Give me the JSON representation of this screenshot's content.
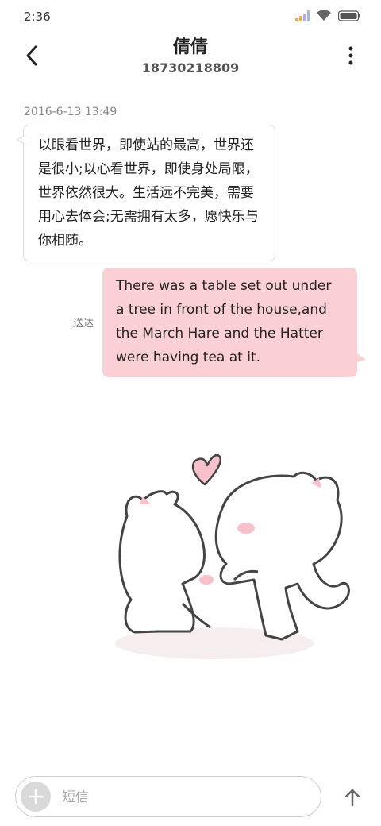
{
  "status_bar": {
    "time": "2:36",
    "signal_icon": "signal-bars-icon",
    "wifi_icon": "wifi-icon",
    "battery_icon": "battery-icon"
  },
  "header": {
    "contact_name": "倩倩",
    "phone": "18730218809",
    "back_icon": "chevron-left-icon",
    "more_icon": "more-vertical-icon"
  },
  "messages": [
    {
      "direction": "incoming",
      "timestamp": "2016-6-13 13:49",
      "text": "以眼看世界，即使站的最高，世界还是很小;以心看世界，即使身处局限，世界依然很大。生活远不完美，需要用心去体会;无需拥有太多，愿快乐与你相随。"
    },
    {
      "direction": "outgoing",
      "status": "送达",
      "text": "There was a table set out under a tree in front of the house,and the March Hare and the Hatter were having tea at it."
    }
  ],
  "sticker": {
    "icon": "kissing-cats-sticker"
  },
  "composer": {
    "placeholder": "短信",
    "add_icon": "plus-icon",
    "send_icon": "arrow-up-icon"
  },
  "colors": {
    "outgoing_bubble": "#fbd0d4",
    "incoming_border": "#dcdcdc",
    "accent_signal": "#f4a93c"
  }
}
